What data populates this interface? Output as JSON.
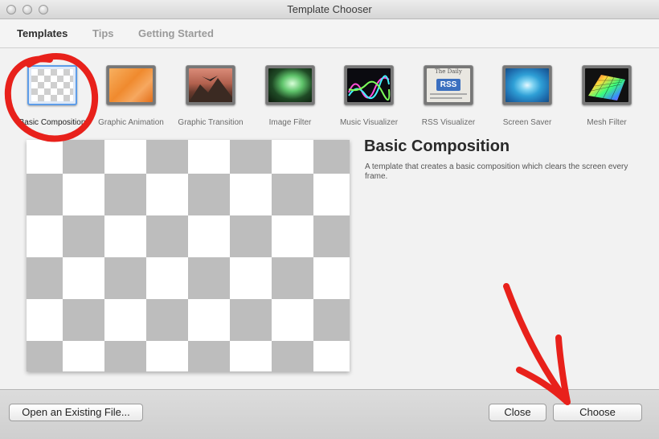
{
  "window": {
    "title": "Template Chooser"
  },
  "tabs": [
    {
      "label": "Templates",
      "active": true
    },
    {
      "label": "Tips",
      "active": false
    },
    {
      "label": "Getting Started",
      "active": false
    }
  ],
  "templates": [
    {
      "label": "Basic Composition",
      "icon": "checkerboard-thumbnail-icon"
    },
    {
      "label": "Graphic Animation",
      "icon": "orange-hexagon-thumbnail-icon"
    },
    {
      "label": "Graphic Transition",
      "icon": "mountain-bird-thumbnail-icon"
    },
    {
      "label": "Image Filter",
      "icon": "glowing-face-thumbnail-icon"
    },
    {
      "label": "Music Visualizer",
      "icon": "spectrum-thumbnail-icon"
    },
    {
      "label": "RSS Visualizer",
      "icon": "rss-newspaper-thumbnail-icon"
    },
    {
      "label": "Screen Saver",
      "icon": "blue-swirl-thumbnail-icon"
    },
    {
      "label": "Mesh Filter",
      "icon": "rainbow-mesh-thumbnail-icon"
    }
  ],
  "selected_template": {
    "title": "Basic Composition",
    "description": "A template that creates a basic composition which clears the screen every frame."
  },
  "thumbnail_text": {
    "rss_badge": "RSS",
    "newspaper_masthead": "The Daily"
  },
  "buttons": {
    "open_existing": "Open an Existing File...",
    "close": "Close",
    "choose": "Choose"
  },
  "colors": {
    "selection_border": "#5d9ce8",
    "annotation_red": "#e8211b",
    "checker_gray": "#bdbdbd",
    "checker_white": "#ffffff"
  }
}
